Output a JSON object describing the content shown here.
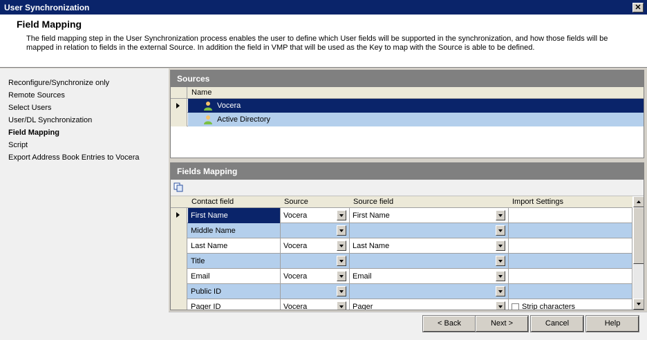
{
  "window": {
    "title": "User Synchronization",
    "close_glyph": "✕"
  },
  "header": {
    "title": "Field Mapping",
    "description": "The field mapping step in the User Synchronization process enables the user to define which User fields will be supported in the synchronization, and how those fields will be mapped in relation to fields in the external Source. In addition the field in VMP that will be used as the Key to map with the Source is able to be defined."
  },
  "nav": {
    "items": [
      {
        "label": "Reconfigure/Synchronize only"
      },
      {
        "label": "Remote Sources"
      },
      {
        "label": "Select Users"
      },
      {
        "label": "User/DL Synchronization"
      },
      {
        "label": "Field Mapping",
        "active": true
      },
      {
        "label": "Script"
      },
      {
        "label": "Export Address Book Entries to Vocera"
      }
    ]
  },
  "sources": {
    "title": "Sources",
    "column": "Name",
    "rows": [
      {
        "name": "Vocera",
        "icon": "user-icon"
      },
      {
        "name": "Active Directory",
        "icon": "user-icon"
      }
    ]
  },
  "fields": {
    "title": "Fields Mapping",
    "toolbar_icon": "copy-icon",
    "columns": {
      "contact": "Contact field",
      "source": "Source",
      "source_field": "Source field",
      "import": "Import Settings"
    },
    "rows": [
      {
        "contact": "First Name",
        "source": "Vocera",
        "source_field": "First Name",
        "import": ""
      },
      {
        "contact": "Middle Name",
        "source": "",
        "source_field": "",
        "import": ""
      },
      {
        "contact": "Last Name",
        "source": "Vocera",
        "source_field": "Last Name",
        "import": ""
      },
      {
        "contact": "Title",
        "source": "",
        "source_field": "",
        "import": ""
      },
      {
        "contact": "Email",
        "source": "Vocera",
        "source_field": "Email",
        "import": ""
      },
      {
        "contact": "Public ID",
        "source": "",
        "source_field": "",
        "import": ""
      },
      {
        "contact": "Pager ID",
        "source": "Vocera",
        "source_field": "Pager",
        "import": "Strip characters"
      }
    ]
  },
  "footer": {
    "back": "< Back",
    "next": "Next >",
    "cancel": "Cancel",
    "help": "Help"
  },
  "colors": {
    "titlebar": "#0a246a",
    "selection": "#0a246a",
    "alt_row": "#b4cfec",
    "panel_header": "#808080"
  }
}
